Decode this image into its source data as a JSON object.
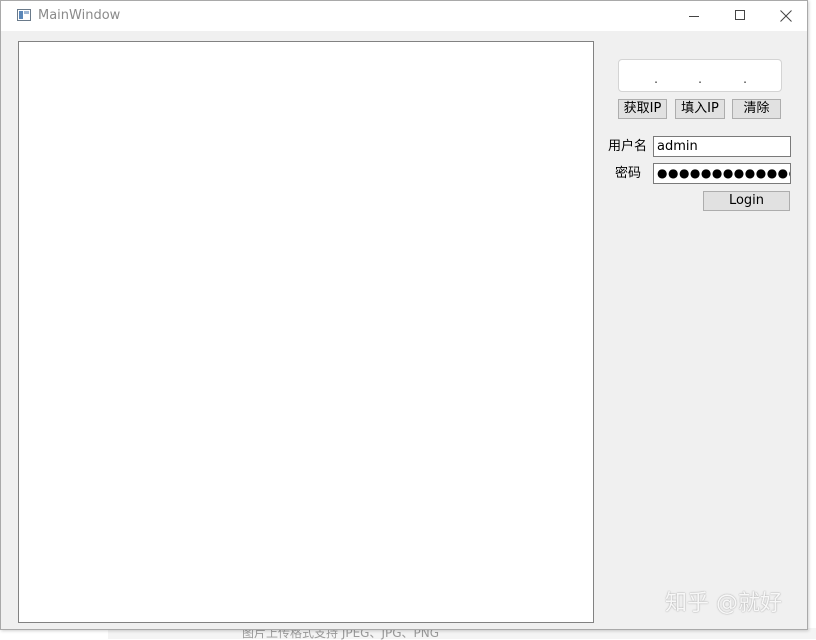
{
  "window": {
    "title": "MainWindow"
  },
  "ip_field": {
    "dots": [
      ".",
      ".",
      "."
    ]
  },
  "buttons": {
    "get_ip": "获取IP",
    "fill_ip": "填入IP",
    "clear": "清除",
    "login": "Login"
  },
  "login_form": {
    "username_label": "用户名",
    "username_value": "admin",
    "password_label": "密码",
    "password_value": "●●●●●●●●●●●●●"
  },
  "background": {
    "caption": "图片上传格式支持 JPEG、JPG、PNG"
  },
  "watermark": {
    "text": "知乎 @就好"
  },
  "colors": {
    "window_bg": "#f0f0f0",
    "titlebar_bg": "#ffffff",
    "button_bg": "#e1e1e1",
    "button_border": "#adadad"
  }
}
